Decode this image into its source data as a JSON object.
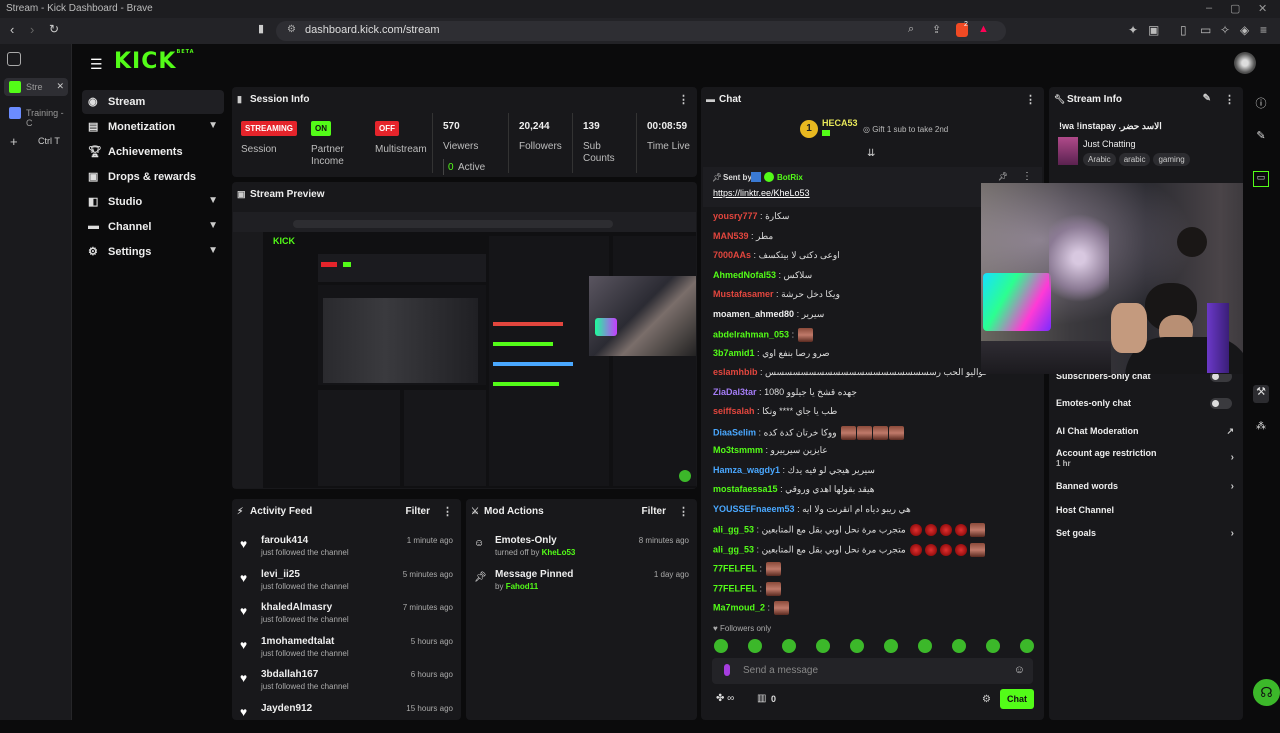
{
  "browser": {
    "window_title": "Stream - Kick Dashboard - Brave",
    "url": "dashboard.kick.com/stream",
    "brave_count": "2",
    "tabs": [
      {
        "label": "Stre"
      },
      {
        "label": "Training - C"
      }
    ],
    "shortcut_label": "Ctrl  T"
  },
  "app": {
    "logo": "KICK",
    "logo_sup": "BETA",
    "nav": [
      {
        "label": "Stream",
        "icon": "stream-icon"
      },
      {
        "label": "Monetization",
        "icon": "monetization-icon"
      },
      {
        "label": "Achievements",
        "icon": "trophy-icon"
      },
      {
        "label": "Drops & rewards",
        "icon": "gift-icon"
      },
      {
        "label": "Studio",
        "icon": "studio-icon"
      },
      {
        "label": "Channel",
        "icon": "channel-icon"
      },
      {
        "label": "Settings",
        "icon": "gear-icon"
      }
    ]
  },
  "session": {
    "title": "Session Info",
    "streaming_badge": "STREAMING",
    "streaming_label": "Session",
    "partner_badge": "ON",
    "partner_label": "Partner\nIncome",
    "multistream_badge": "OFF",
    "multistream_label": "Multistream",
    "viewers_value": "570",
    "viewers_label": "Viewers",
    "active_value": "0",
    "active_label": "Active",
    "followers_value": "20,244",
    "followers_label": "Followers",
    "subs_value": "139",
    "subs_label": "Sub\nCounts",
    "time_value": "00:08:59",
    "time_label": "Time Live"
  },
  "preview": {
    "title": "Stream Preview"
  },
  "activity": {
    "title": "Activity Feed",
    "filter_label": "Filter",
    "items": [
      {
        "name": "farouk414",
        "sub": "just followed the channel",
        "time": "1 minute ago"
      },
      {
        "name": "levi_ii25",
        "sub": "just followed the channel",
        "time": "5 minutes ago"
      },
      {
        "name": "khaledAlmasry",
        "sub": "just followed the channel",
        "time": "7 minutes ago"
      },
      {
        "name": "1mohamedtalat",
        "sub": "just followed the channel",
        "time": "5 hours ago"
      },
      {
        "name": "3bdallah167",
        "sub": "just followed the channel",
        "time": "6 hours ago"
      },
      {
        "name": "Jayden912",
        "sub": "",
        "time": "15 hours ago"
      }
    ]
  },
  "mod_actions": {
    "title": "Mod Actions",
    "filter_label": "Filter",
    "items": [
      {
        "action": "Emotes-Only",
        "detail_prefix": "turned off by",
        "user": "KheLo53",
        "time": "8 minutes ago"
      },
      {
        "action": "Message Pinned",
        "detail_prefix": "by",
        "user": "Fahod11",
        "time": "1 day ago"
      }
    ]
  },
  "chat": {
    "title": "Chat",
    "gifter": "HECA53",
    "gifter_count": "1",
    "gift_prompt": "Gift 1 sub to take 2nd",
    "pinned_sent_by": "Sent by",
    "pinned_user": "BotRix",
    "pinned_link": "https://linktr.ee/KheLo53",
    "messages": [
      {
        "user": "yousry777",
        "text": ": سكارة",
        "color": "#e2463e"
      },
      {
        "user": "MAN539",
        "text": ": مطر",
        "color": "#e2463e"
      },
      {
        "user": "7000AAs",
        "text": ": اوعى دكتى لا بيتكسف",
        "color": "#e2463e"
      },
      {
        "user": "AhmedNofal53",
        "text": ": سلاكس",
        "color": "#53fc18"
      },
      {
        "user": "Mustafasamer",
        "text": ": ويكا دخل حرشة",
        "color": "#e2463e"
      },
      {
        "user": "moamen_ahmed80",
        "text": ": سيرير",
        "color": "#eeeeee"
      },
      {
        "user": "abdelrahman_053",
        "text": ":",
        "color": "#53fc18"
      },
      {
        "user": "3b7amid1",
        "text": ": صرو رصا بنفع اوي",
        "color": "#53fc18"
      },
      {
        "user": "eslamhbib",
        "text": ": خواليو الحب رسسسسسسسسسسسسسسسسسسسسس",
        "color": "#e2463e"
      },
      {
        "user": "ZiaDal3tar",
        "text": ": جهده قشخ يا جيلوو 1080",
        "color": "#a47cf5"
      },
      {
        "user": "seiffsalah",
        "text": ": طب يا جاي **** ونكا",
        "color": "#e2463e"
      },
      {
        "user": "DiaaSelim",
        "text": ": ووكا خرتان كدة كده",
        "color": "#4aa8ff"
      },
      {
        "user": "Mo3tsmmm",
        "text": ": عايزين سيرييرو",
        "color": "#53fc18"
      },
      {
        "user": "Hamza_wagdy1",
        "text": ": سيرير هيجي لو فيه يدك",
        "color": "#4aa8ff"
      },
      {
        "user": "mostafaessa15",
        "text": ": هيقد بقولها اهدي وروقي",
        "color": "#53fc18"
      },
      {
        "user": "YOUSSEFnaeem53",
        "text": ": هي ريبو دياه ام انقرنت ولا ايه",
        "color": "#4aa8ff"
      },
      {
        "user": "ali_gg_53",
        "text": ": متجرب مرة نحل اوبي بقل مع المتابعين",
        "color": "#53fc18"
      },
      {
        "user": "ali_gg_53",
        "text": ": متجرب مرة نحل اوبي بقل مع المتابعين",
        "color": "#53fc18"
      },
      {
        "user": "77FELFEL",
        "text": ":",
        "color": "#53fc18"
      },
      {
        "user": "77FELFEL",
        "text": ":",
        "color": "#53fc18"
      },
      {
        "user": "Ma7moud_2",
        "text": ":",
        "color": "#53fc18"
      }
    ],
    "followers_only": "Followers only",
    "input_placeholder": "Send a message",
    "points": "0",
    "send_label": "Chat"
  },
  "stream_info": {
    "title": "Stream Info",
    "stream_title": "!wa !instapay .الاسد حضر",
    "category": "Just Chatting",
    "tags": [
      "Arabic",
      "arabic",
      "gaming"
    ],
    "settings": [
      {
        "label": "Subscribers-only chat",
        "type": "toggle"
      },
      {
        "label": "Emotes-only chat",
        "type": "toggle"
      },
      {
        "label": "AI Chat Moderation",
        "type": "link"
      },
      {
        "label": "Account age restriction",
        "sub": "1 hr",
        "type": "arrow"
      },
      {
        "label": "Banned words",
        "type": "arrow"
      },
      {
        "label": "Host Channel",
        "type": "none"
      },
      {
        "label": "Set goals",
        "type": "arrow"
      }
    ]
  },
  "colors": {
    "accent": "#53fc18",
    "panel": "#18181b",
    "bg": "#0b0b0c",
    "live_red": "#e5242b"
  }
}
